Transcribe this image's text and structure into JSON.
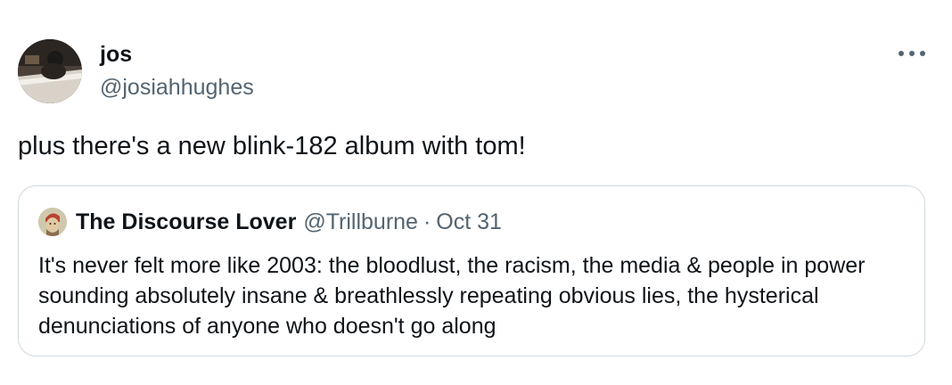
{
  "author": {
    "display_name": "jos",
    "handle": "@josiahhughes",
    "avatar_icon": "user-avatar-photo"
  },
  "tweet": {
    "text": "plus there's a new blink-182 album with tom!",
    "more_icon": "ellipsis-horizontal-icon"
  },
  "quoted_tweet": {
    "display_name": "The Discourse Lover",
    "handle": "@Trillburne",
    "separator": "·",
    "date": "Oct 31",
    "text": "It's never felt more like 2003: the bloodlust, the racism, the media & people in power sounding absolutely insane & breathlessly repeating obvious lies, the hysterical denunciations of anyone who doesn't go along",
    "avatar_icon": "quoted-user-avatar-illustration"
  },
  "colors": {
    "text_primary": "#0f1419",
    "text_secondary": "#536471",
    "border": "#cfd9de",
    "background": "#ffffff"
  }
}
